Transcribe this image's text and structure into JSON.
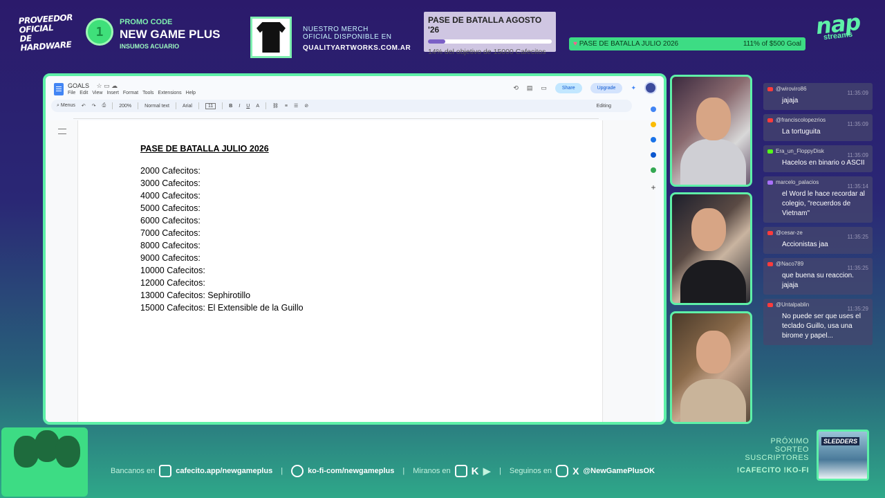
{
  "overlay": {
    "sponsor_text": "PROVEEDOR OFICIAL DE HARDWARE",
    "promo": {
      "label": "PROMO CODE",
      "code": "NEW GAME PLUS",
      "partner": "INSUMOS ACUARIO"
    },
    "merch": {
      "line1": "NUESTRO MERCH",
      "line2": "OFICIAL DISPONIBLE EN",
      "url": "QUALITYARTWORKS.COM.AR"
    },
    "goal_top": {
      "title": "PASE DE BATALLA AGOSTO '26",
      "progress_percent": 14,
      "subtitle": "14% del objetivo de 15000 Cafecitos"
    },
    "goal_bar": {
      "label": "PASE DE BATALLA JULIO 2026",
      "value": "111% of $500 Goal"
    },
    "logo": {
      "big": "nap",
      "small": "streams"
    }
  },
  "docs": {
    "title": "GOALS",
    "menus": [
      "File",
      "Edit",
      "View",
      "Insert",
      "Format",
      "Tools",
      "Extensions",
      "Help"
    ],
    "share_label": "Share",
    "upgrade_label": "Upgrade",
    "toolbar": {
      "menus": "Menus",
      "zoom": "200%",
      "style": "Normal text",
      "font": "Arial",
      "size": "11",
      "mode": "Editing"
    },
    "heading": "PASE DE BATALLA JULIO 2026",
    "lines": [
      "2000 Cafecitos:",
      "3000 Cafecitos:",
      "4000 Cafecitos:",
      "5000 Cafecitos:",
      "6000 Cafecitos:",
      "7000 Cafecitos:",
      "8000 Cafecitos:",
      "9000 Cafecitos:",
      "10000 Cafecitos:",
      "12000 Cafecitos:",
      "13000 Cafecitos: Sephirotillo",
      "15000 Cafecitos: El Extensible de la Guillo"
    ]
  },
  "chat": [
    {
      "user": "@wiroviro86",
      "time": "11:35:09",
      "text": "jajaja",
      "platform": "youtube",
      "color": "#ff3b3b"
    },
    {
      "user": "@franciscolopezrios",
      "time": "11:35:09",
      "text": "La tortuguita",
      "platform": "youtube",
      "color": "#ff3b3b"
    },
    {
      "user": "Era_un_FloppyDisk",
      "time": "11:35:09",
      "text": "Hacelos en binario o ASCII",
      "platform": "kick",
      "color": "#53fc18"
    },
    {
      "user": "marcelo_palacios",
      "time": "11:35:14",
      "text": "el Word le hace recordar al colegio, \"recuerdos de Vietnam\"",
      "platform": "twitch",
      "color": "#a970ff"
    },
    {
      "user": "@cesar-ze",
      "time": "11:35:25",
      "text": "Accionistas jaa",
      "platform": "youtube",
      "color": "#ff3b3b"
    },
    {
      "user": "@Naco789",
      "time": "11:35:25",
      "text": "que buena su reaccion. jajaja",
      "platform": "youtube",
      "color": "#ff3b3b"
    },
    {
      "user": "@Untalpablin",
      "time": "11:35:29",
      "text": "No puede ser que uses el teclado Guillo, usa una birome y papel...",
      "platform": "youtube",
      "color": "#ff3b3b"
    }
  ],
  "footer": {
    "bancanos": "Bancanos en",
    "cafecito": "cafecito.app/newgameplus",
    "kofi": "ko-fi-com/newgameplus",
    "miranos": "Miranos en",
    "seguinos": "Seguinos en",
    "handle": "@NewGamePlusOK",
    "sorteo": [
      "PRÓXIMO",
      "SORTEO",
      "SUSCRIPTORES"
    ],
    "commands": "!CAFECITO !KO-FI",
    "game_title": "SLEDDERS"
  }
}
